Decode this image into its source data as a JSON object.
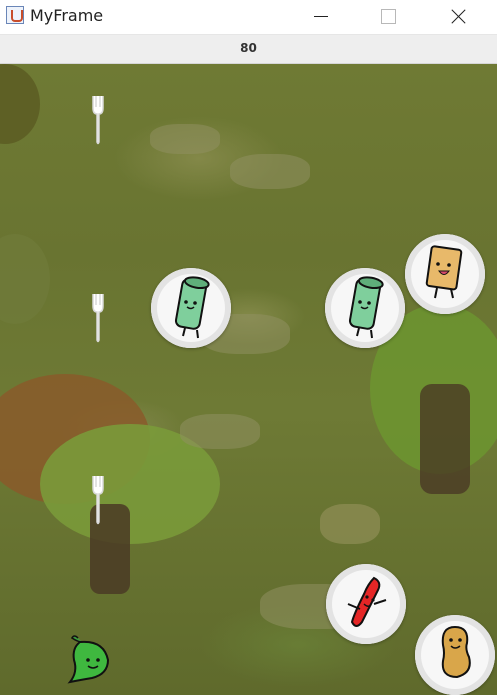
{
  "window": {
    "title": "MyFrame"
  },
  "score": "80",
  "icons": {
    "app": "java-coffee-icon",
    "minimize": "minimize-icon",
    "maximize": "maximize-icon",
    "close": "close-icon"
  },
  "game": {
    "forks": 3,
    "plates": [
      "green-sushi-roll",
      "green-sushi-roll",
      "toast-slice",
      "red-chili",
      "peanut"
    ],
    "player": "green-pepper"
  }
}
